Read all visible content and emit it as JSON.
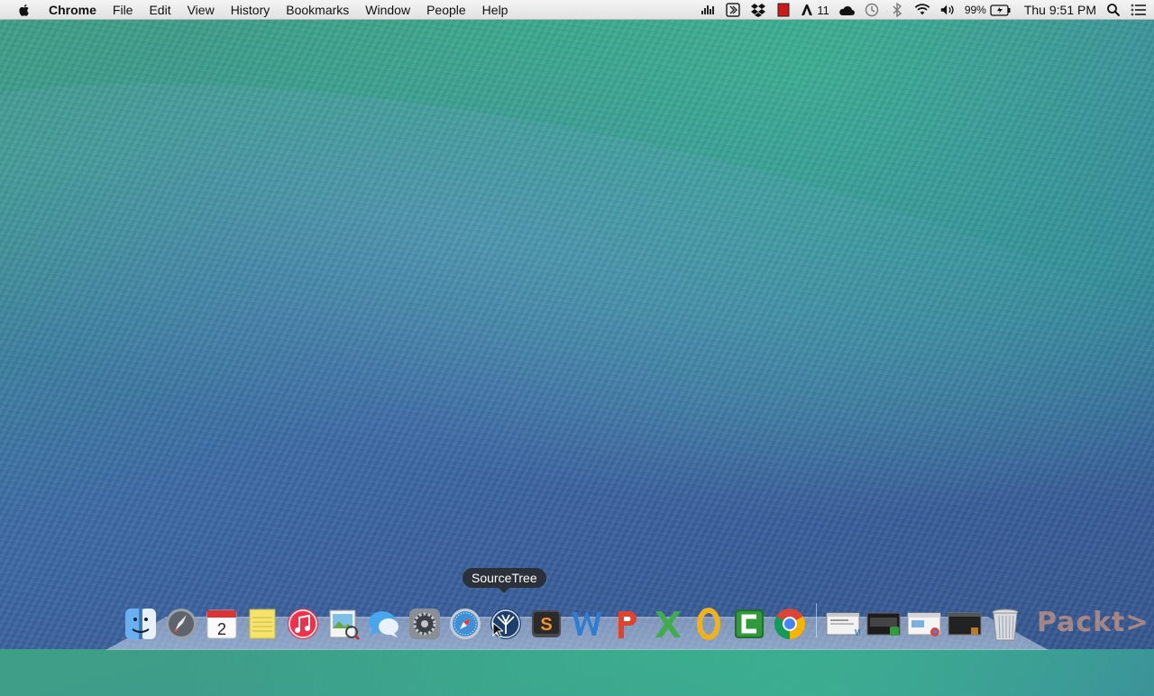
{
  "menubar": {
    "app_name": "Chrome",
    "items": [
      "File",
      "Edit",
      "View",
      "History",
      "Bookmarks",
      "Window",
      "People",
      "Help"
    ],
    "status": {
      "adobe_count": "11",
      "battery": "99%",
      "clock": "Thu 9:51 PM"
    }
  },
  "dock": {
    "tooltip": "SourceTree",
    "apps": [
      {
        "name": "Finder",
        "icon": "finder-icon"
      },
      {
        "name": "Launchpad",
        "icon": "launchpad-icon"
      },
      {
        "name": "Calendar",
        "icon": "calendar-icon",
        "badge": "2"
      },
      {
        "name": "Stickies",
        "icon": "stickies-icon"
      },
      {
        "name": "iTunes",
        "icon": "itunes-icon"
      },
      {
        "name": "Preview",
        "icon": "preview-icon"
      },
      {
        "name": "Messages",
        "icon": "messages-icon"
      },
      {
        "name": "System Preferences",
        "icon": "system-preferences-icon"
      },
      {
        "name": "Safari",
        "icon": "safari-icon"
      },
      {
        "name": "SourceTree",
        "icon": "sourcetree-icon"
      },
      {
        "name": "Sublime Text",
        "icon": "sublime-text-icon"
      },
      {
        "name": "Word",
        "icon": "word-icon"
      },
      {
        "name": "PowerPoint",
        "icon": "powerpoint-icon"
      },
      {
        "name": "Excel",
        "icon": "excel-icon"
      },
      {
        "name": "Outlook",
        "icon": "outlook-icon"
      },
      {
        "name": "Camtasia",
        "icon": "camtasia-icon"
      },
      {
        "name": "Chrome",
        "icon": "chrome-icon"
      }
    ],
    "minimized": [
      "minimized-window-word",
      "minimized-window-camtasia",
      "minimized-window-chrome",
      "minimized-window-terminal"
    ],
    "trash_icon": "trash-icon"
  },
  "watermark": "Packt>",
  "colors": {
    "menubar_bg": "#e9e9e9",
    "tooltip_bg": "#2c2c2c"
  }
}
